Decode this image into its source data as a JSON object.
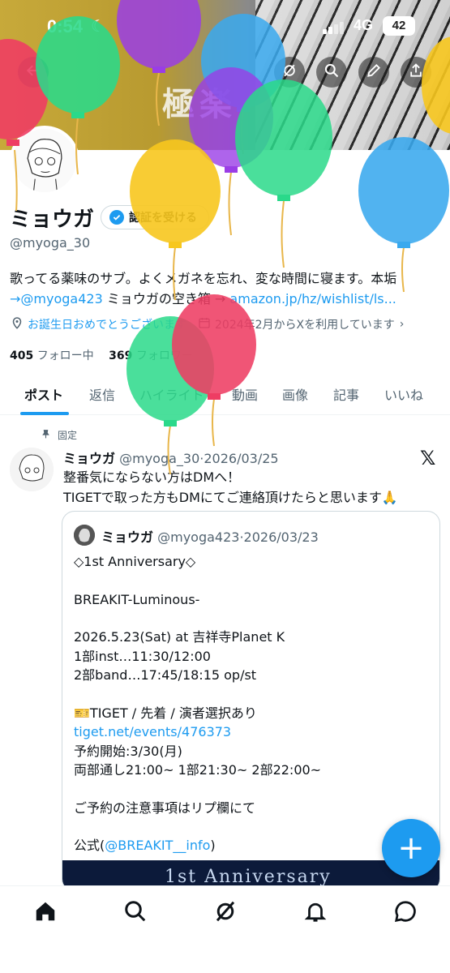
{
  "status_bar": {
    "time": "0:54",
    "network": "4G",
    "battery": "42"
  },
  "banner": {
    "text": "極楽"
  },
  "profile": {
    "display_name": "ミョウガ",
    "verify_label": "認証を受ける",
    "handle": "@myoga_30",
    "bio_line1": "歌ってる薬味のサブ。よくメガネを忘れ、変な時間に寝ます。本垢",
    "bio_arrow1": "→",
    "bio_mention": "@myoga423",
    "bio_mid": " ミョウガの空き箱 → ",
    "bio_link": "amazon.jp/hz/wishlist/ls...",
    "birthday": "お誕生日おめでとうございます",
    "joined": "2024年2月からXを利用しています",
    "following_count": "405",
    "following_label": "フォロー中",
    "followers_count": "369",
    "followers_label": "フォロワー"
  },
  "tabs": [
    {
      "label": "ポスト"
    },
    {
      "label": "返信"
    },
    {
      "label": "ハイライト"
    },
    {
      "label": "動画"
    },
    {
      "label": "画像"
    },
    {
      "label": "記事"
    },
    {
      "label": "いいね"
    }
  ],
  "post": {
    "pinned_label": "固定",
    "author": "ミョウガ",
    "handle": "@myoga_30",
    "sep": "·",
    "date": "2026/03/25",
    "line1": "整番気にならない方はDMへ！",
    "line2": "TIGETで取った方もDMにてご連絡頂けたらと思います🙏",
    "quote": {
      "author": "ミョウガ",
      "handle": "@myoga423",
      "sep": "·",
      "date": "2026/03/23",
      "l1": "◇1st Anniversary◇",
      "l2": "BREAKIT-Luminous-",
      "l3": "2026.5.23(Sat) at 吉祥寺Planet K",
      "l4": "1部inst…11:30/12:00",
      "l5": "2部band…17:45/18:15 op/st",
      "l6": "🎫TIGET / 先着 / 演者選択あり",
      "l7": "tiget.net/events/476373",
      "l8": "予約開始:3/30(月)",
      "l9": "両部通し21:00~ 1部21:30~ 2部22:00~",
      "l10": "ご予約の注意事項はリプ欄にて",
      "l11a": "公式(",
      "l11b": "@BREAKIT__info",
      "l11c": ")",
      "image_text": "1st Anniversary"
    }
  },
  "fab_label": "+",
  "colors": {
    "accent": "#1d9bf0",
    "text": "#0f1419",
    "muted": "#536471"
  },
  "icons": {
    "top_bar": [
      "back-arrow-icon",
      "grok-icon",
      "search-icon",
      "edit-icon",
      "share-icon"
    ],
    "bottom_nav": [
      "home-icon",
      "search-icon",
      "grok-icon",
      "notifications-icon",
      "messages-icon"
    ]
  }
}
